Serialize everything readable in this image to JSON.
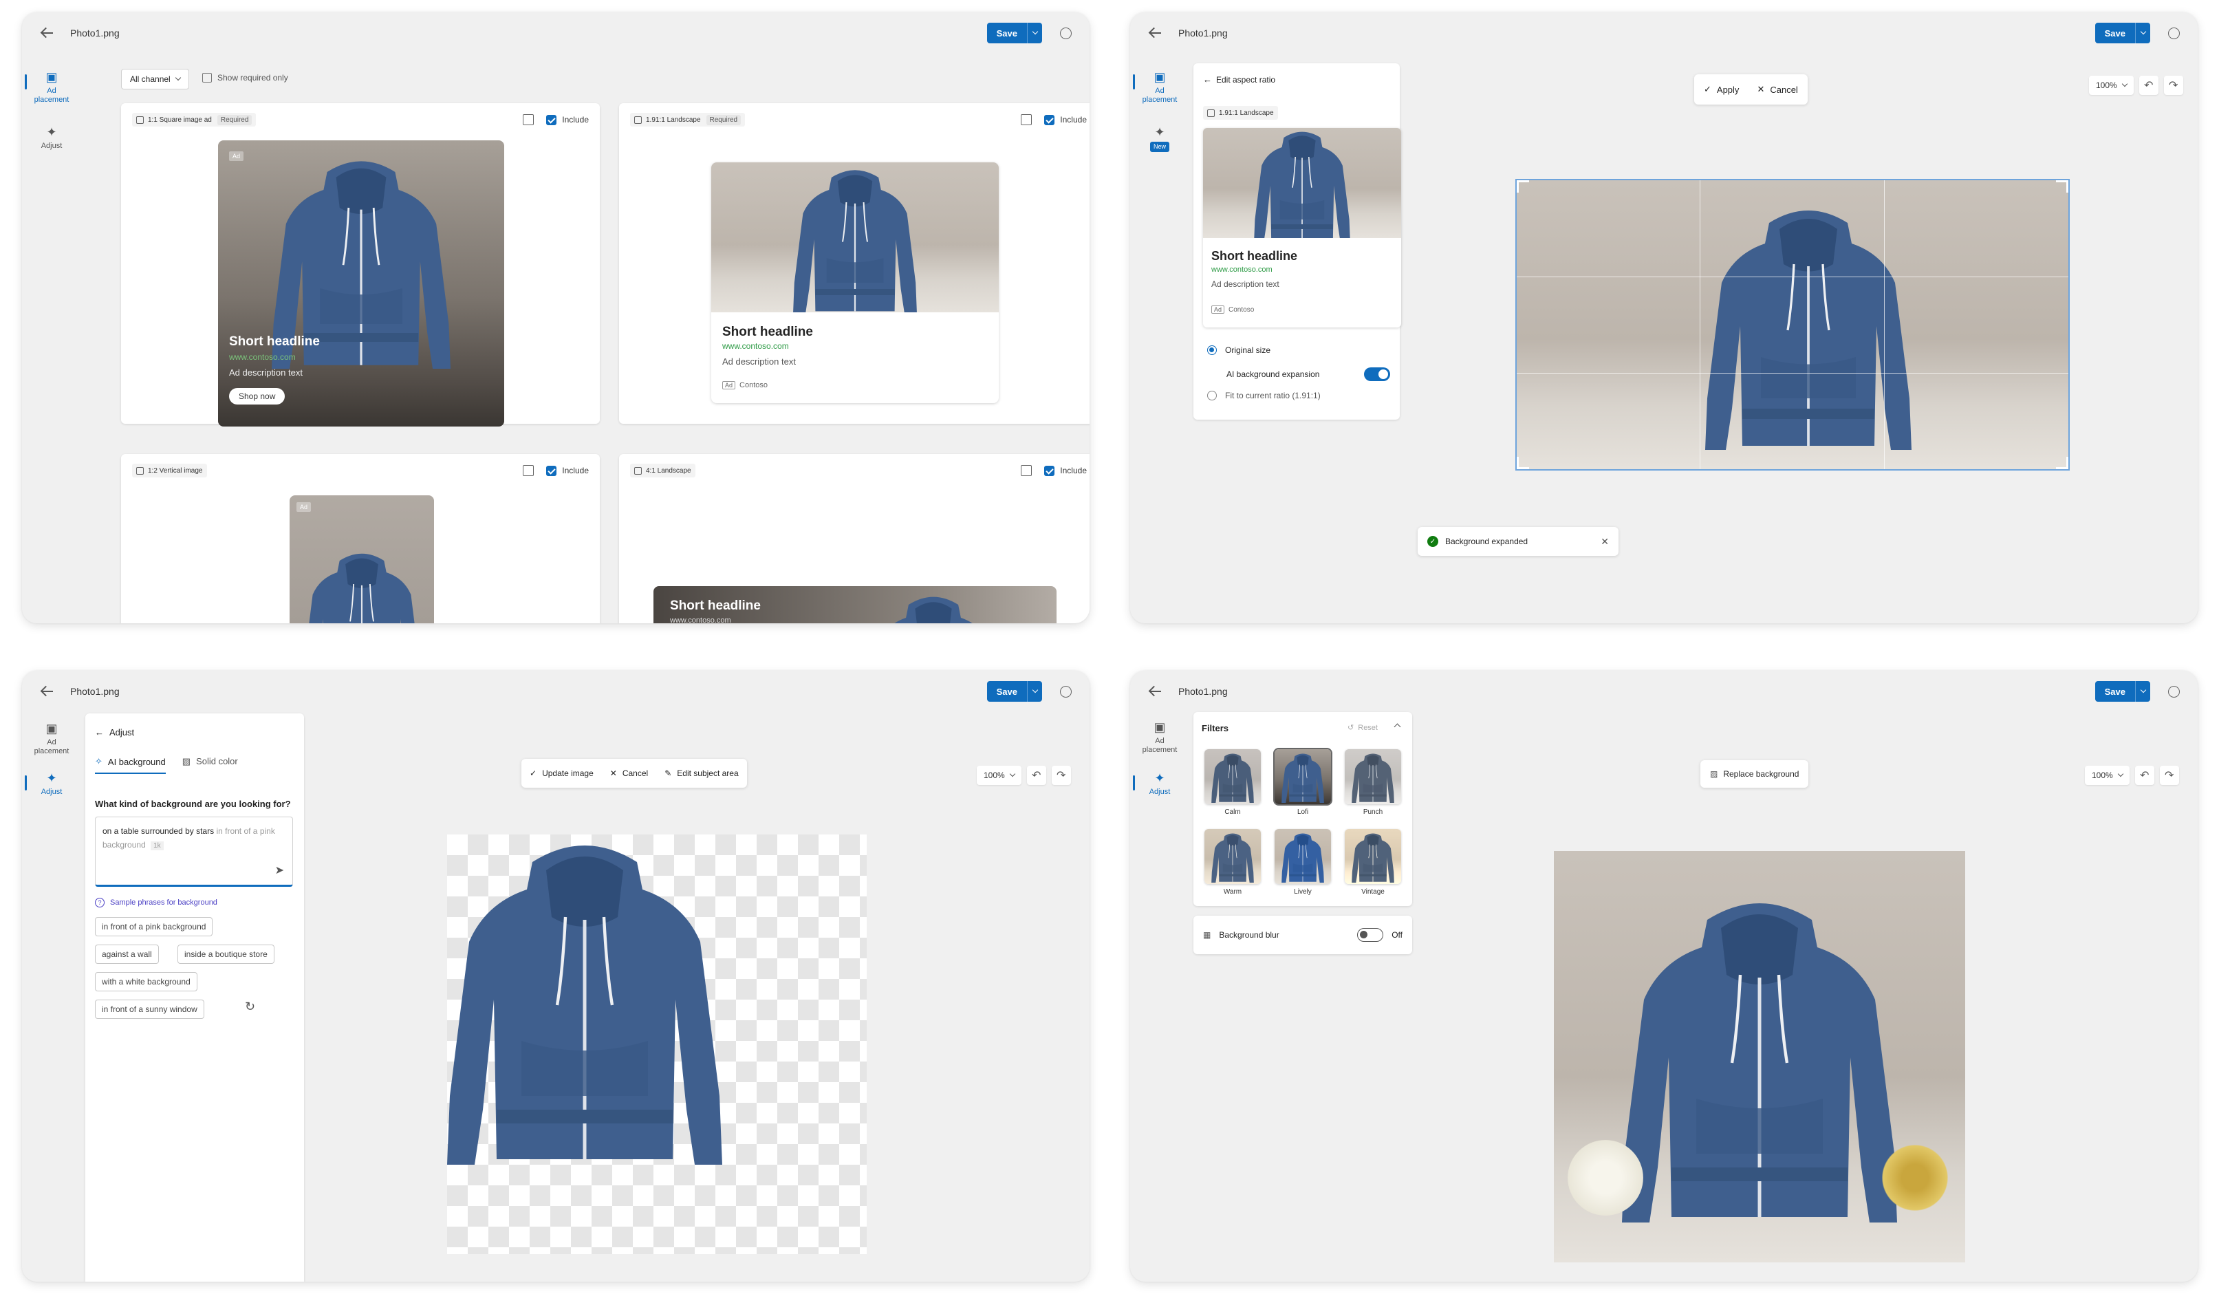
{
  "common": {
    "file_name": "Photo1.png",
    "save_label": "Save",
    "rail_ad_placement": "Ad placement",
    "rail_adjust": "Adjust",
    "rail_new_badge": "New",
    "zoom_level": "100%"
  },
  "w1": {
    "channel_filter": "All channel",
    "show_required": "Show required only",
    "include_label": "Include",
    "required_label": "Required",
    "cards": [
      {
        "tag": "1:1 Square image ad",
        "required": true
      },
      {
        "tag": "1.91:1 Landscape",
        "required": true
      },
      {
        "tag": "1:2 Vertical image",
        "required": false
      },
      {
        "tag": "4:1 Landscape",
        "required": false
      }
    ],
    "ad": {
      "headline": "Short headline",
      "url": "www.contoso.com",
      "description": "Ad description text",
      "cta": "Shop now",
      "ad_badge": "Ad",
      "brand": "Contoso"
    }
  },
  "w2": {
    "panel_back": "Edit aspect ratio",
    "tag": "1.91:1 Landscape",
    "headline": "Short headline",
    "url": "www.contoso.com",
    "description": "Ad description text",
    "ad_badge": "Ad",
    "brand": "Contoso",
    "opt_original": "Original size",
    "opt_ai_expansion": "AI background expansion",
    "opt_fit": "Fit to current ratio (1.91:1)",
    "apply": "Apply",
    "cancel": "Cancel",
    "toast": "Background expanded"
  },
  "w3": {
    "panel_back": "Adjust",
    "tab_ai": "AI background",
    "tab_solid": "Solid color",
    "question": "What kind of background are you looking for?",
    "prompt_typed": "on a table surrounded by stars",
    "prompt_suggest": " in front of a pink background",
    "prompt_count": "1k",
    "sample_title": "Sample phrases for background",
    "chips": [
      "in front of a pink background",
      "against a wall",
      "inside a boutique store",
      "with a white background",
      "in front of a sunny window"
    ],
    "update_image": "Update image",
    "cancel": "Cancel",
    "edit_subject": "Edit subject area"
  },
  "w4": {
    "filters_title": "Filters",
    "reset": "Reset",
    "filters": [
      "Calm",
      "Lofi",
      "Punch",
      "Warm",
      "Lively",
      "Vintage"
    ],
    "blur_label": "Background blur",
    "blur_state": "Off",
    "replace_bg": "Replace background"
  }
}
